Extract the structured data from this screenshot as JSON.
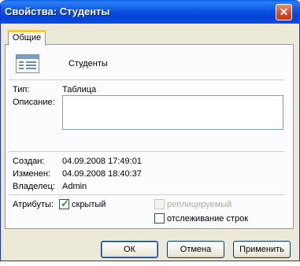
{
  "window": {
    "title": "Свойства: Студенты",
    "close_glyph": "✕"
  },
  "tabs": [
    {
      "label": "Общие"
    }
  ],
  "object": {
    "name": "Студенты",
    "icon": "table-icon"
  },
  "fields": {
    "type_label": "Тип:",
    "type_value": "Таблица",
    "description_label": "Описание:",
    "description_value": "",
    "created_label": "Создан:",
    "created_value": "04.09.2008 17:49:01",
    "modified_label": "Изменен:",
    "modified_value": "04.09.2008 18:40:37",
    "owner_label": "Владелец:",
    "owner_value": "Admin"
  },
  "attributes": {
    "label": "Атрибуты:",
    "hidden": {
      "label": "скрытый",
      "checked": true
    },
    "replicated": {
      "label": "реплицируемый",
      "checked": false,
      "enabled": false
    },
    "row_tracking": {
      "label": "отслеживание строк",
      "checked": false
    }
  },
  "buttons": {
    "ok": "ОК",
    "cancel": "Отмена",
    "apply": "Применить"
  },
  "colors": {
    "titlebar": "#0b55e3",
    "dialog_bg": "#ece9d8",
    "tab_accent": "#ffc83c",
    "check": "#21a121"
  }
}
